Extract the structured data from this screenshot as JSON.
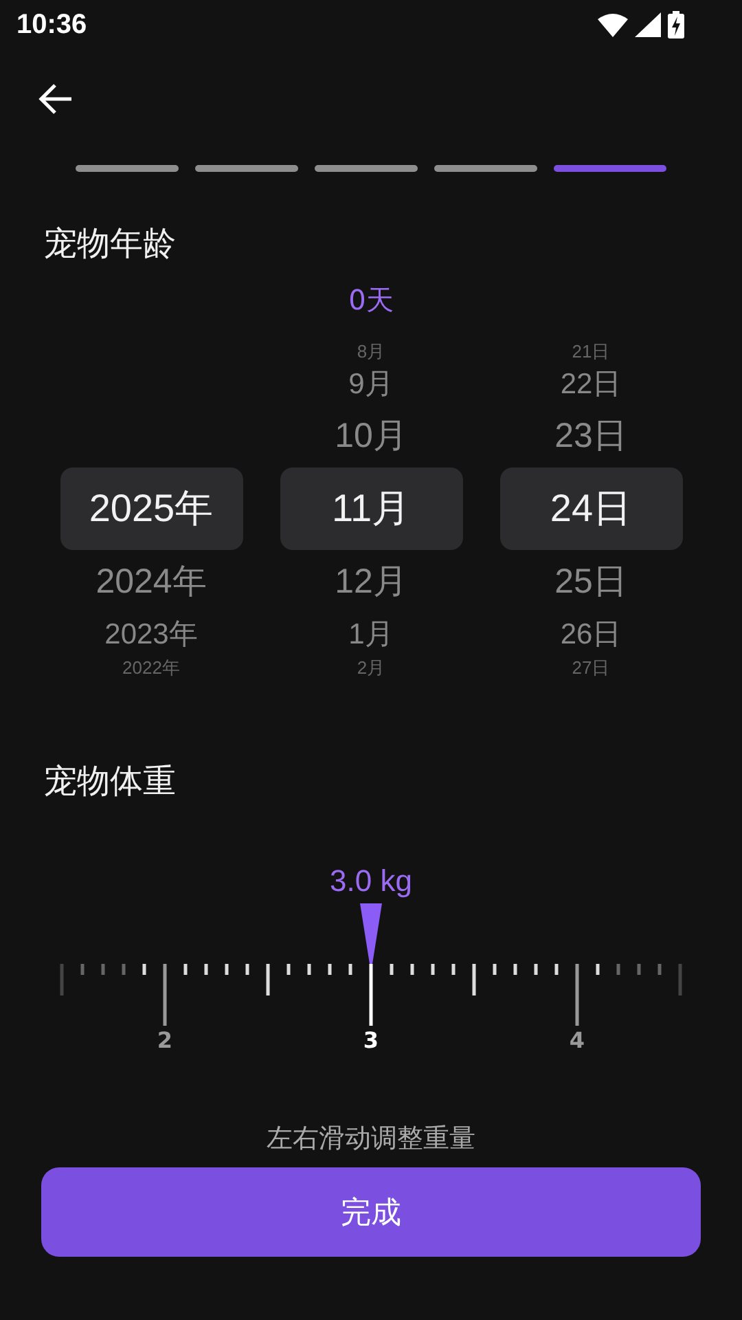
{
  "status_bar": {
    "time": "10:36"
  },
  "steps": [
    {
      "selected": false
    },
    {
      "selected": false
    },
    {
      "selected": false
    },
    {
      "selected": false
    },
    {
      "selected": true
    }
  ],
  "age": {
    "title": "宠物年龄",
    "summary": "0天",
    "columns": [
      {
        "items": [
          {
            "label": "2025年",
            "selected": true
          },
          {
            "label": "2024年",
            "selected": false
          },
          {
            "label": "2023年",
            "selected": false
          },
          {
            "label": "2022年",
            "selected": false
          }
        ]
      },
      {
        "items": [
          {
            "label": "8月",
            "selected": false
          },
          {
            "label": "9月",
            "selected": false
          },
          {
            "label": "10月",
            "selected": false
          },
          {
            "label": "11月",
            "selected": true
          },
          {
            "label": "12月",
            "selected": false
          },
          {
            "label": "1月",
            "selected": false
          },
          {
            "label": "2月",
            "selected": false
          }
        ]
      },
      {
        "items": [
          {
            "label": "21日",
            "selected": false
          },
          {
            "label": "22日",
            "selected": false
          },
          {
            "label": "23日",
            "selected": false
          },
          {
            "label": "24日",
            "selected": true
          },
          {
            "label": "25日",
            "selected": false
          },
          {
            "label": "26日",
            "selected": false
          },
          {
            "label": "27日",
            "selected": false
          }
        ]
      }
    ]
  },
  "weight": {
    "title": "宠物体重",
    "reading": "3.0 kg",
    "marks": [
      {
        "label": "2",
        "selected": false
      },
      {
        "label": "3",
        "selected": true
      },
      {
        "label": "4",
        "selected": false
      }
    ],
    "hint": "左右滑动调整重量"
  },
  "done_button": "完成"
}
